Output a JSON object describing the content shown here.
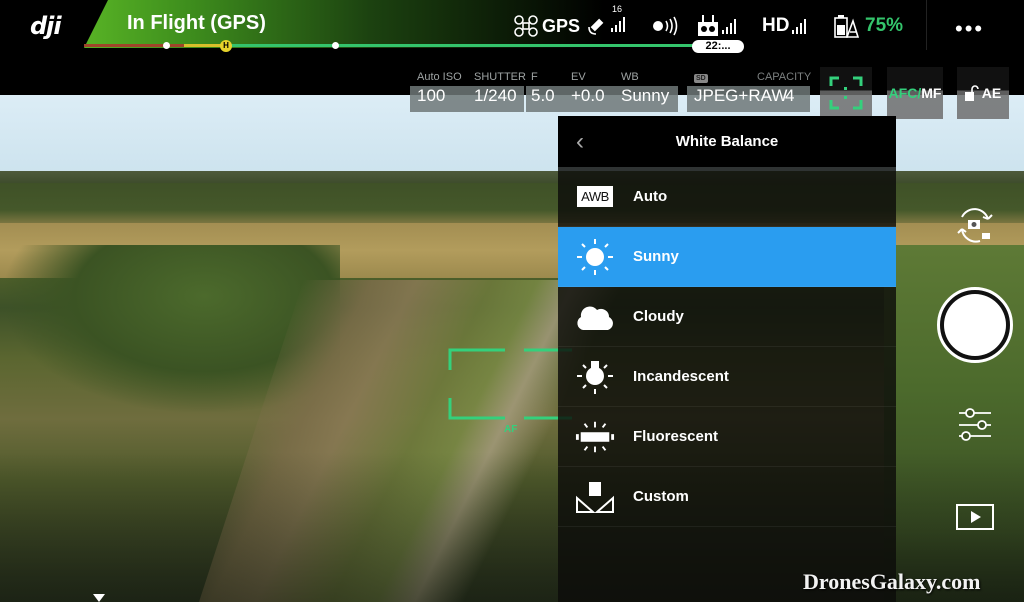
{
  "app": {
    "logo": "dji",
    "flight_status": "In Flight (GPS)",
    "flight_time": "22:..."
  },
  "status_icons": {
    "gps_label": "GPS",
    "satellite_count": "16",
    "hd_label": "HD",
    "battery_percent": "75%",
    "more_menu": "•••"
  },
  "camera_params": [
    {
      "label": "Auto ISO",
      "value": "100"
    },
    {
      "label": "SHUTTER",
      "value": "1/240"
    },
    {
      "label": "F",
      "value": "5.0"
    },
    {
      "label": "EV",
      "value": "+0.0"
    },
    {
      "label": "WB",
      "value": "Sunny"
    }
  ],
  "storage": {
    "badge": "SD",
    "format": "JPEG+RAW",
    "capacity_label": "CAPACITY",
    "capacity_value": "4"
  },
  "focus_controls": {
    "focus_mode_afc": "AFC",
    "focus_mode_sep": "/",
    "focus_mode_mf": "MF",
    "ae_lock": "AE",
    "af_label": "AF"
  },
  "white_balance": {
    "title": "White Balance",
    "selected": "Sunny",
    "options": [
      {
        "label": "Auto",
        "icon": "awb-icon",
        "badge": "AWB"
      },
      {
        "label": "Sunny",
        "icon": "sun-icon"
      },
      {
        "label": "Cloudy",
        "icon": "cloud-icon"
      },
      {
        "label": "Incandescent",
        "icon": "bulb-icon"
      },
      {
        "label": "Fluorescent",
        "icon": "fluorescent-icon"
      },
      {
        "label": "Custom",
        "icon": "custom-wb-icon"
      }
    ]
  },
  "colors": {
    "accent_green": "#34c46c",
    "selected_blue": "#2a9df0",
    "home_yellow": "#e6d22b"
  },
  "watermark": "DronesGalaxy.com"
}
